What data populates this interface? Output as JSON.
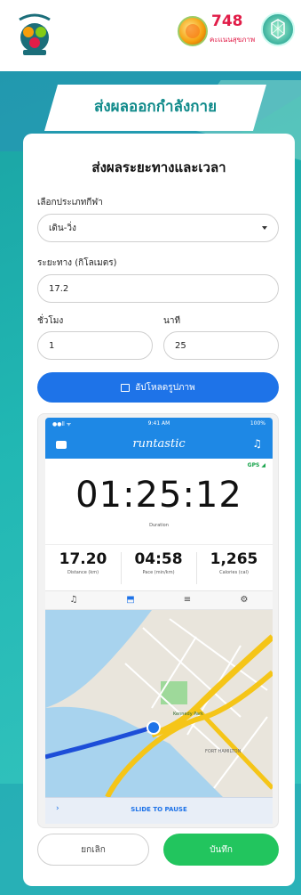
{
  "header": {
    "points_value": "748",
    "points_label": "คะแนนสุขภาพ"
  },
  "banner": {
    "title": "ส่งผลออกกำลังกาย"
  },
  "form": {
    "title": "ส่งผลระยะทางและเวลา",
    "sport_label": "เลือกประเภทกีฬา",
    "sport_value": "เดิน-วิ่ง",
    "distance_label": "ระยะทาง (กิโลเมตร)",
    "distance_value": "17.2",
    "hours_label": "ชั่วโมง",
    "hours_value": "1",
    "minutes_label": "นาที",
    "minutes_value": "25",
    "upload_label": "อัปโหลดรูปภาพ"
  },
  "screenshot": {
    "status_left": "●●ll ᯤ",
    "status_time": "9:41 AM",
    "status_right": "100%",
    "brand": "runtastic",
    "gps": "GPS ◢",
    "duration": "01:25:12",
    "duration_label": "Duration",
    "stats": [
      {
        "value": "17.20",
        "label": "Distance (km)"
      },
      {
        "value": "04:58",
        "label": "Pace (min/km)"
      },
      {
        "value": "1,265",
        "label": "Calories (cal)"
      }
    ],
    "map_label_1": "Kennedy Park",
    "map_label_2": "FORT HAMILTON",
    "slide_text": "SLIDE TO PAUSE"
  },
  "actions": {
    "cancel_label": "ยกเลิก",
    "save_label": "บันทึก"
  },
  "colors": {
    "primary_blue": "#1e73e8",
    "save_green": "#22c55e",
    "teal_bg": "#21b7b3",
    "points_red": "#e11d48"
  }
}
